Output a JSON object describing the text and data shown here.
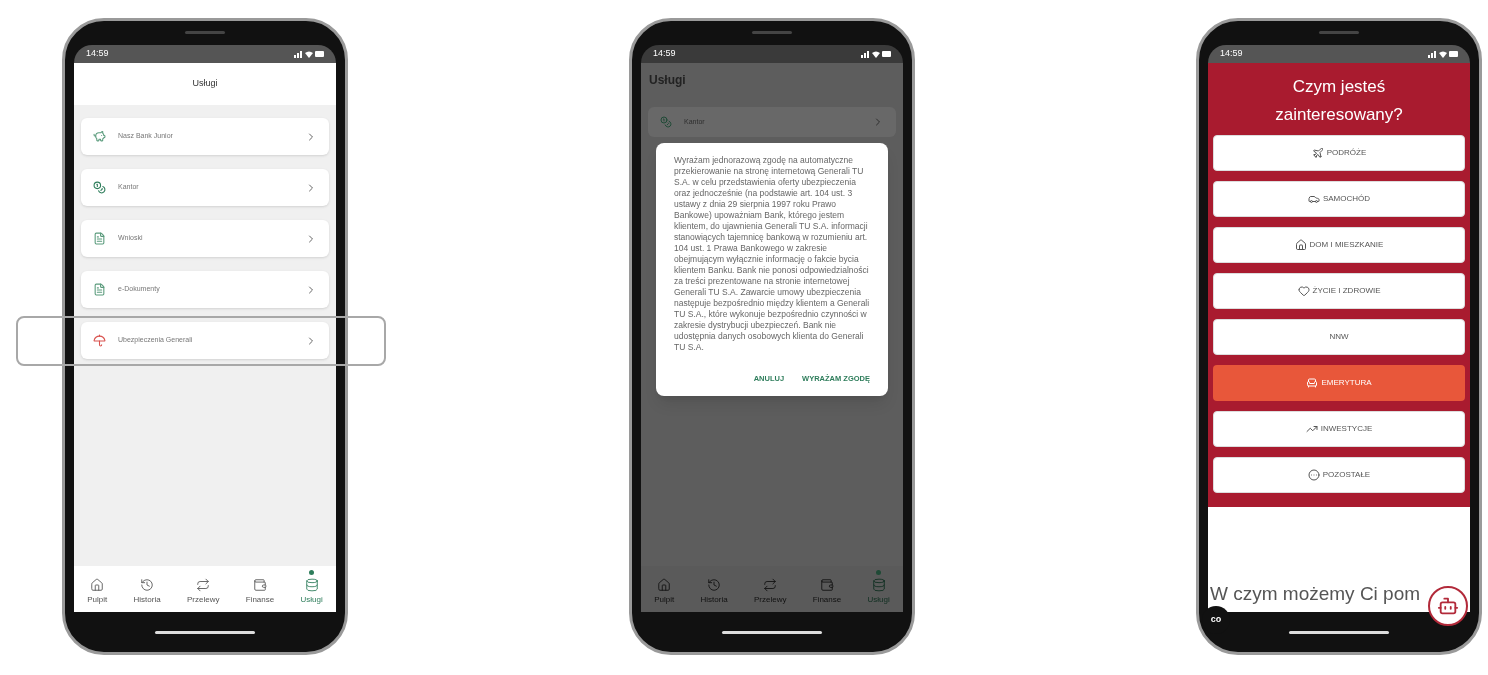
{
  "phones": [
    {
      "kind": "services_list",
      "status_time": "14:59",
      "title": "Usługi",
      "items": [
        {
          "label": "Nasz Bank Junior",
          "highlighted": false
        },
        {
          "label": "Kantor",
          "highlighted": false
        },
        {
          "label": "Wnioski",
          "highlighted": false
        },
        {
          "label": "e-Dokumenty",
          "highlighted": false
        },
        {
          "label": "Ubezpieczenia Generali",
          "highlighted": true
        }
      ],
      "nav": [
        {
          "label": "Pulpit",
          "selected": false
        },
        {
          "label": "Historia",
          "selected": false
        },
        {
          "label": "Przelewy",
          "selected": false
        },
        {
          "label": "Finanse",
          "selected": false
        },
        {
          "label": "Usługi",
          "selected": true
        }
      ]
    },
    {
      "kind": "consent_dialog",
      "status_time": "14:59",
      "title": "Usługi",
      "items": [
        {
          "label": "Kantor",
          "highlighted": false
        }
      ],
      "dialog": {
        "text": "Wyrażam jednorazową zgodę na automatyczne przekierowanie na stronę internetową Generali TU S.A. w celu przedstawienia oferty ubezpieczenia oraz jednocześnie (na podstawie art. 104 ust. 3 ustawy z dnia 29 sierpnia 1997 roku Prawo Bankowe) upoważniam Bank, którego jestem klientem, do ujawnienia Generali TU S.A. informacji stanowiących tajemnicę bankową w rozumieniu art. 104 ust. 1 Prawa Bankowego w zakresie obejmującym wyłącznie informację o fakcie bycia klientem Banku. Bank nie ponosi odpowiedzialności za treści prezentowane na stronie internetowej Generali TU S.A. Zawarcie umowy ubezpieczenia następuje bezpośrednio między klientem a Generali TU S.A., które wykonuje bezpośrednio czynności w zakresie dystrybucji ubezpieczeń. Bank nie udostępnia danych osobowych klienta do Generali TU S.A.",
        "buttons": [
          "ANULUJ",
          "WYRAŻAM ZGODĘ"
        ]
      },
      "nav": [
        {
          "label": "Pulpit",
          "selected": false
        },
        {
          "label": "Historia",
          "selected": false
        },
        {
          "label": "Przelewy",
          "selected": false
        },
        {
          "label": "Finanse",
          "selected": false
        },
        {
          "label": "Usługi",
          "selected": true
        }
      ]
    },
    {
      "kind": "insurance_picker",
      "status_time": "14:59",
      "title": "Czym jesteś zainteresowany?",
      "options": [
        {
          "label": "PODRÓŻE",
          "selected": false
        },
        {
          "label": "SAMOCHÓD",
          "selected": false
        },
        {
          "label": "DOM I MIESZKANIE",
          "selected": false
        },
        {
          "label": "ŻYCIE I ZDROWIE",
          "selected": false
        },
        {
          "label": "NNW",
          "selected": false
        },
        {
          "label": "EMERYTURA",
          "selected": true
        },
        {
          "label": "INWESTYCJE",
          "selected": false
        },
        {
          "label": "POZOSTAŁE",
          "selected": false
        }
      ],
      "chat_prompt": "W czym możemy Ci pom",
      "badge": "co"
    }
  ]
}
